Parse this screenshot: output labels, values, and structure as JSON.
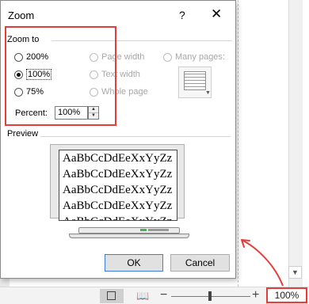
{
  "dialog": {
    "title": "Zoom",
    "help": "?",
    "close": "✕",
    "zoom_to": "Zoom to",
    "options": {
      "z200": "200%",
      "z100": "100%",
      "z75": "75%",
      "page_width": "Page width",
      "text_width": "Text width",
      "whole_page": "Whole page",
      "many_pages": "Many pages:"
    },
    "selected": "100%",
    "percent_label": "Percent:",
    "percent_value": "100%",
    "preview_label": "Preview",
    "preview_lines": [
      "AaBbCcDdEeXxYyZz",
      "AaBbCcDdEeXxYyZz",
      "AaBbCcDdEeXxYyZz",
      "AaBbCcDdEeXxYyZz",
      "AaBbCcDdEeXxYyZz"
    ],
    "ok": "OK",
    "cancel": "Cancel"
  },
  "statusbar": {
    "zoom_level": "100%",
    "minus": "−",
    "plus": "+"
  },
  "colors": {
    "highlight": "#e53c3c",
    "ok_border": "#3c7fd6"
  }
}
